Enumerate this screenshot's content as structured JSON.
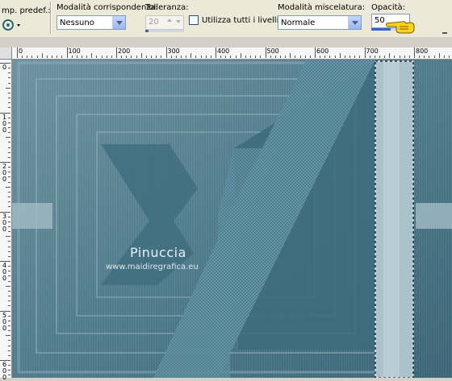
{
  "toolbar": {
    "preset_label": "mp. predef.:",
    "match_mode": {
      "label": "Modalità corrispondenza:",
      "value": "Nessuno"
    },
    "tolerance": {
      "label": "Tolleranza:",
      "value": "20"
    },
    "use_all_layers_label": "Utilizza tutti i livelli",
    "blend_mode": {
      "label": "Modalità miscelatura:",
      "value": "Normale"
    },
    "opacity": {
      "label": "Opacità:",
      "value": "50"
    }
  },
  "rulers": {
    "top_ticks": [
      "0",
      "100",
      "200",
      "300",
      "400",
      "500",
      "600",
      "700",
      "800"
    ],
    "left_ticks": [
      "0",
      "100",
      "200",
      "300",
      "400",
      "500",
      "600"
    ]
  },
  "canvas": {
    "watermark_title": "Pinuccia",
    "watermark_url": "www.maidiregrafica.eu"
  },
  "colors": {
    "accent": "#3a6a7c",
    "stripe": "#a9c2cb"
  }
}
